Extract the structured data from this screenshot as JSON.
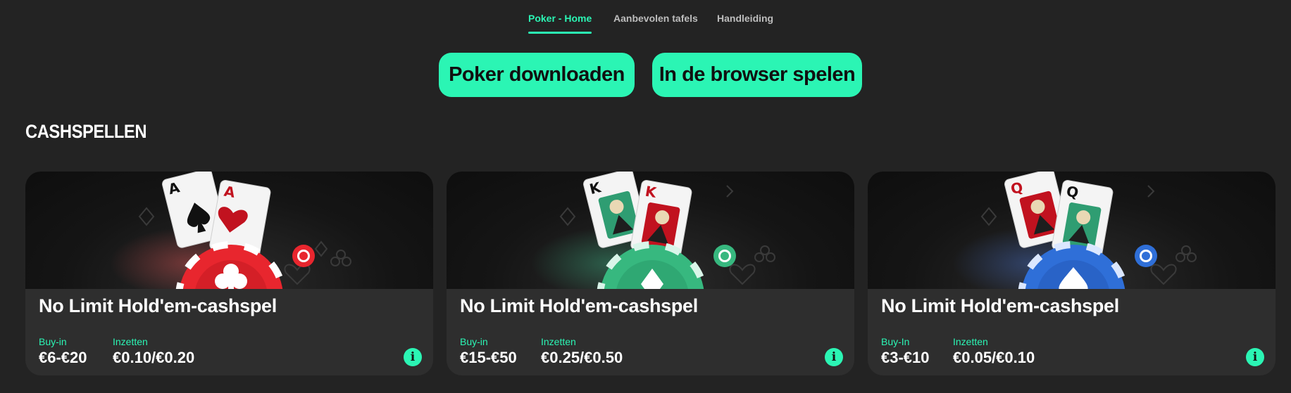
{
  "nav": {
    "tabs": [
      {
        "label": "Poker - Home",
        "active": true
      },
      {
        "label": "Aanbevolen tafels",
        "active": false
      },
      {
        "label": "Handleiding",
        "active": false
      }
    ]
  },
  "cta": {
    "download_label": "Poker downloaden",
    "browser_label": "In de browser spelen"
  },
  "section_title": "CASHSPELLEN",
  "colors": {
    "background": "#232323",
    "card": "#2e2e2e",
    "accent": "#2bf5b4"
  },
  "cards": [
    {
      "title": "No Limit Hold'em-cashspel",
      "buyin_label": "Buy-in",
      "buyin_value": "€6-€20",
      "stakes_label": "Inzetten",
      "stakes_value": "€0.10/€0.20",
      "chip_color": "#e8262e",
      "cards": [
        "A spades",
        "A hearts"
      ],
      "info_icon": "info-icon"
    },
    {
      "title": "No Limit Hold'em-cashspel",
      "buyin_label": "Buy-in",
      "buyin_value": "€15-€50",
      "stakes_label": "Inzetten",
      "stakes_value": "€0.25/€0.50",
      "chip_color": "#37b87f",
      "cards": [
        "K spades",
        "K hearts"
      ],
      "info_icon": "info-icon"
    },
    {
      "title": "No Limit Hold'em-cashspel",
      "buyin_label": "Buy-In",
      "buyin_value": "€3-€10",
      "stakes_label": "Inzetten",
      "stakes_value": "€0.05/€0.10",
      "chip_color": "#2f6fd8",
      "cards": [
        "Q hearts",
        "Q spades"
      ],
      "info_icon": "info-icon"
    }
  ]
}
